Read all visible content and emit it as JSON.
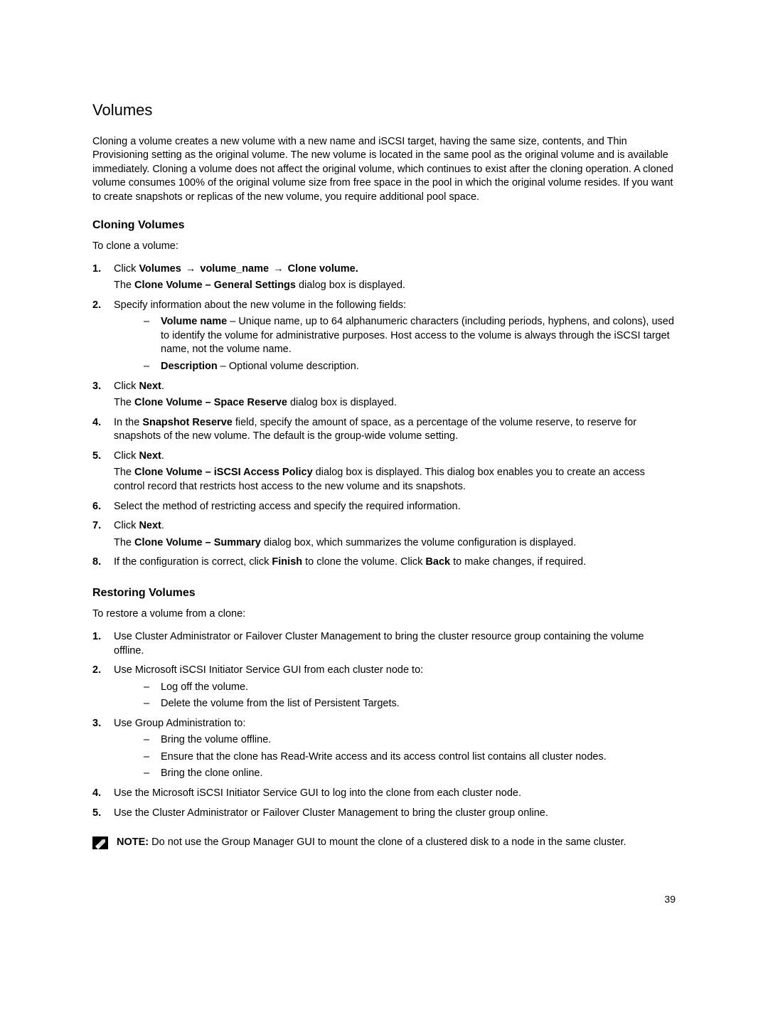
{
  "title": "Volumes",
  "intro": "Cloning a volume creates a new volume with a new name and iSCSI target, having the same size, contents, and Thin Provisioning setting as the original volume. The new volume is located in the same pool as the original volume and is available immediately. Cloning a volume does not affect the original volume, which continues to exist after the cloning operation. A cloned volume consumes 100% of the original volume size from free space in the pool in which the original volume resides. If you want to create snapshots or replicas of the new volume, you require additional pool space.",
  "cloning": {
    "heading": "Cloning Volumes",
    "lead": "To clone a volume:",
    "steps": {
      "s1_num": "1.",
      "s1_prefix": "Click ",
      "s1_b1": "Volumes",
      "s1_arrow": " → ",
      "s1_b2": "volume_name",
      "s1_b3": "Clone volume.",
      "s1_sub": "The ",
      "s1_sub_b": "Clone Volume – General Settings",
      "s1_sub_tail": " dialog box is displayed.",
      "s2_num": "2.",
      "s2_text": "Specify information about the new volume in the following fields:",
      "s2_a_b": "Volume name",
      "s2_a_text": " – Unique name, up to 64 alphanumeric characters (including periods, hyphens, and colons), used to identify the volume for administrative purposes. Host access to the volume is always through the iSCSI target name, not the volume name.",
      "s2_b_b": "Description",
      "s2_b_text": " – Optional volume description.",
      "s3_num": "3.",
      "s3_prefix": "Click ",
      "s3_b": "Next",
      "s3_suffix": ".",
      "s3_sub": "The ",
      "s3_sub_b": "Clone Volume – Space Reserve",
      "s3_sub_tail": " dialog box is displayed.",
      "s4_num": "4.",
      "s4_prefix": "In the ",
      "s4_b": "Snapshot Reserve",
      "s4_suffix": " field, specify the amount of space, as a percentage of the volume reserve, to reserve for snapshots of the new volume. The default is the group-wide volume setting.",
      "s5_num": "5.",
      "s5_prefix": "Click ",
      "s5_b": "Next",
      "s5_suffix": ".",
      "s5_sub": "The ",
      "s5_sub_b": "Clone Volume – iSCSI Access Policy",
      "s5_sub_tail": " dialog box is displayed. This dialog box enables you to create an access control record that restricts host access to the new volume and its snapshots.",
      "s6_num": "6.",
      "s6_text": "Select the method of restricting access and specify the required information.",
      "s7_num": "7.",
      "s7_prefix": "Click ",
      "s7_b": "Next",
      "s7_suffix": ".",
      "s7_sub": "The ",
      "s7_sub_b": "Clone Volume – Summary",
      "s7_sub_tail": " dialog box, which summarizes the volume configuration is displayed.",
      "s8_num": "8.",
      "s8_prefix": "If the configuration is correct, click ",
      "s8_b1": "Finish",
      "s8_mid": " to clone the volume. Click ",
      "s8_b2": "Back",
      "s8_suffix": " to make changes, if required."
    }
  },
  "restoring": {
    "heading": "Restoring Volumes",
    "lead": "To restore a volume from a clone:",
    "steps": {
      "r1_num": "1.",
      "r1_text": "Use Cluster Administrator or Failover Cluster Management to bring the cluster resource group containing the volume offline.",
      "r2_num": "2.",
      "r2_text": "Use Microsoft iSCSI Initiator Service GUI from each cluster node to:",
      "r2_a": "Log off the volume.",
      "r2_b": "Delete the volume from the list of Persistent Targets.",
      "r3_num": "3.",
      "r3_text": "Use Group Administration to:",
      "r3_a": "Bring the volume offline.",
      "r3_b": "Ensure that the clone has Read-Write access and its access control list contains all cluster nodes.",
      "r3_c": "Bring the clone online.",
      "r4_num": "4.",
      "r4_text": "Use the Microsoft iSCSI Initiator Service GUI to log into the clone from each cluster node.",
      "r5_num": "5.",
      "r5_text": "Use the Cluster Administrator or Failover Cluster Management to bring the cluster group online."
    }
  },
  "note_label": "NOTE:",
  "note_text": " Do not use the Group Manager GUI to mount the clone of a clustered disk to a node in the same cluster.",
  "page_number": "39",
  "dash": "–"
}
